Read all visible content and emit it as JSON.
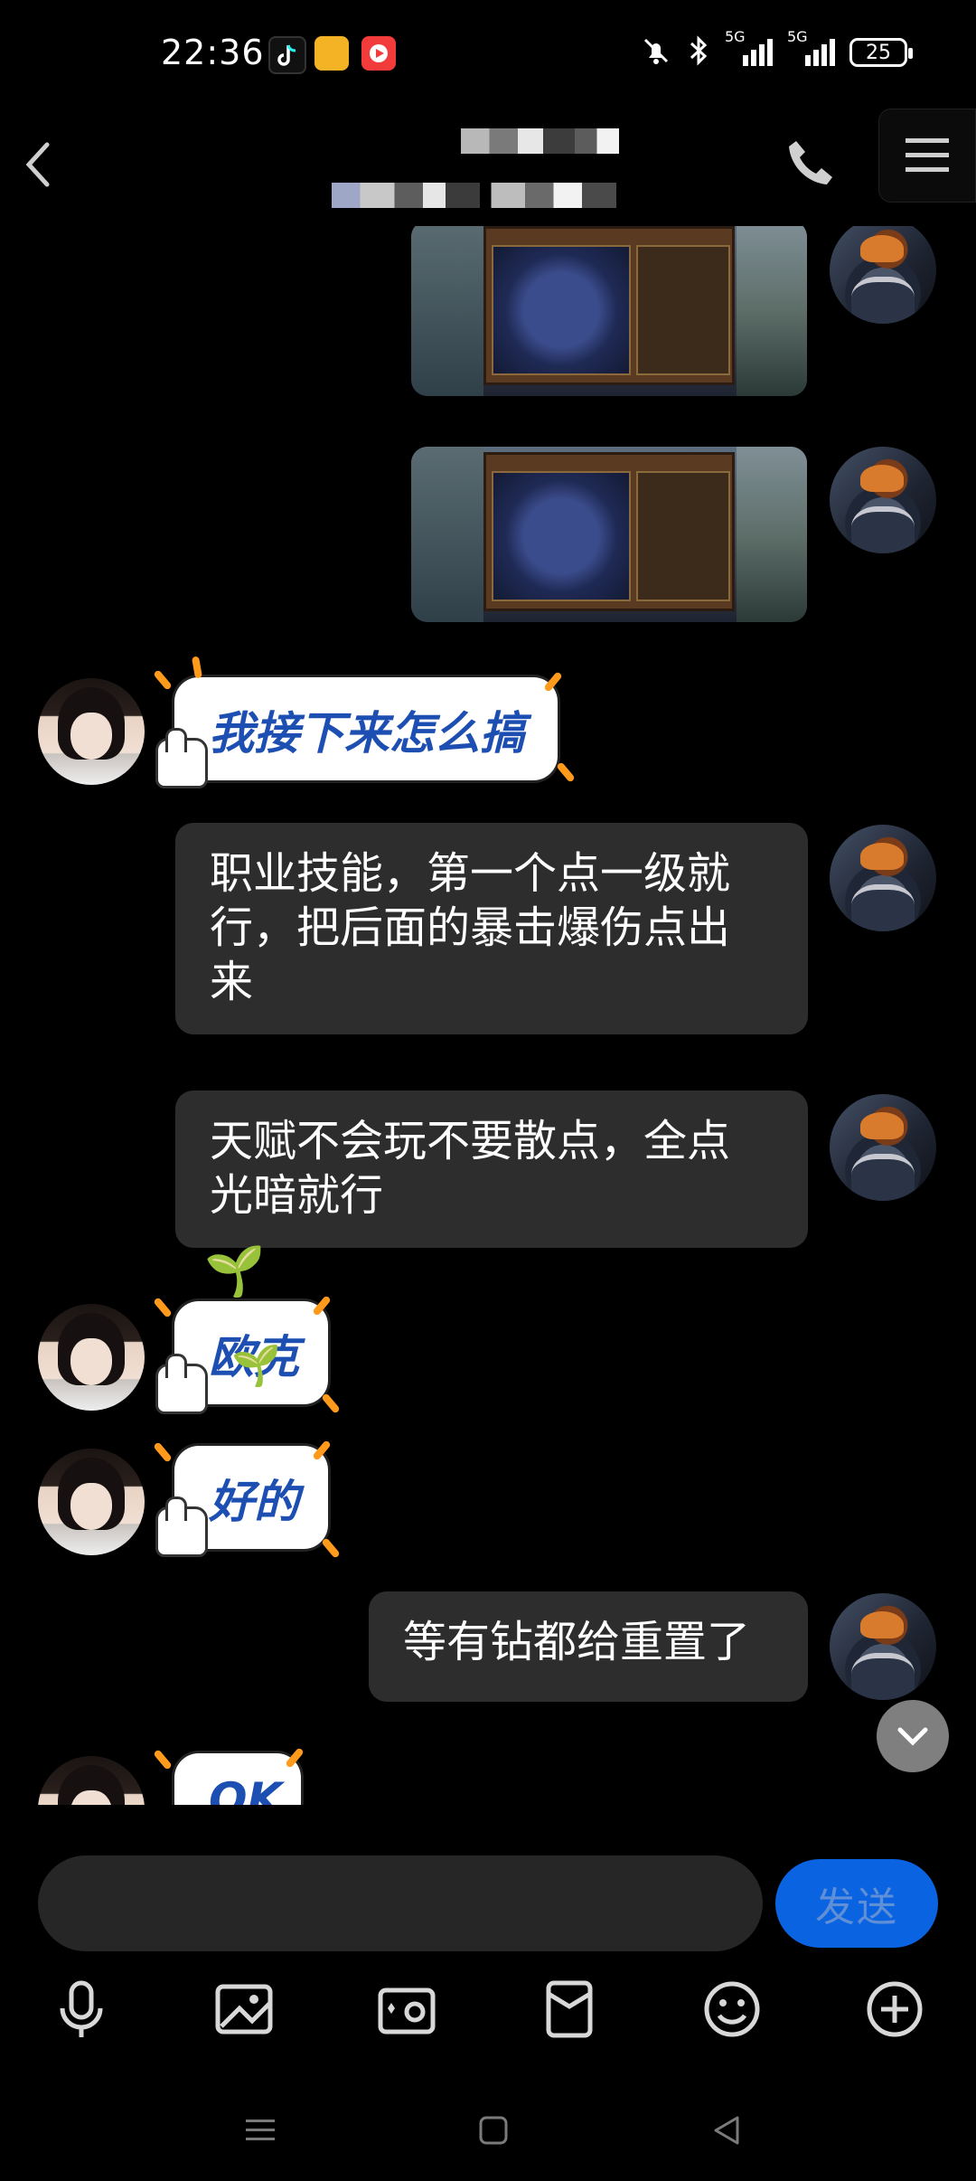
{
  "status_bar": {
    "time": "22:36",
    "network_labels": [
      "5G",
      "5G"
    ],
    "battery_level": "25",
    "icons": [
      "tiktok-icon",
      "game-app-icon",
      "video-app-icon",
      "mute-icon",
      "bluetooth-icon",
      "signal-icon",
      "signal-icon"
    ]
  },
  "header": {
    "icons": [
      "back-icon",
      "phone-icon",
      "menu-icon"
    ]
  },
  "messages": [
    {
      "type": "image",
      "sender": "self"
    },
    {
      "type": "image",
      "sender": "self"
    },
    {
      "type": "sticker",
      "sender": "other",
      "text": "我接下来怎么搞"
    },
    {
      "type": "text",
      "sender": "self",
      "text": "职业技能，第一个点一级就\n行，把后面的暴击爆伤点出\n来"
    },
    {
      "type": "text",
      "sender": "self",
      "text": "天赋不会玩不要散点，全点\n光暗就行"
    },
    {
      "type": "sticker",
      "sender": "other",
      "text": "欧克"
    },
    {
      "type": "sticker",
      "sender": "other",
      "text": "好的"
    },
    {
      "type": "text",
      "sender": "self",
      "text": "等有钻都给重置了"
    },
    {
      "type": "sticker",
      "sender": "other",
      "text": "OK"
    }
  ],
  "input": {
    "value": "",
    "send_label": "发送"
  },
  "toolbar": {
    "icons": [
      "microphone-icon",
      "image-icon",
      "camera-icon",
      "red-packet-icon",
      "emoji-icon",
      "plus-icon"
    ]
  },
  "colors": {
    "background": "#000000",
    "bubble_self": "#2d2d2d",
    "send_button": "#0a63e0",
    "sticker_text": "#1d4fb3"
  }
}
